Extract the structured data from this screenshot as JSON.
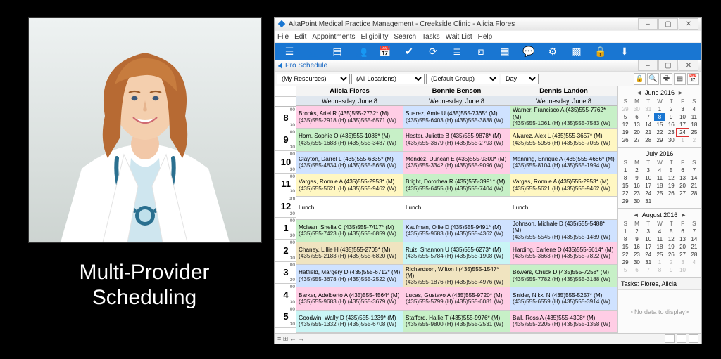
{
  "caption": "Multi-Provider Scheduling",
  "window": {
    "title": "AltaPoint Medical Practice Management - Creekside Clinic - Alicia Flores",
    "menu": [
      "File",
      "Edit",
      "Appointments",
      "Eligibility",
      "Search",
      "Tasks",
      "Wait List",
      "Help"
    ],
    "sub_title": "Pro Schedule",
    "filters": {
      "resources": "(My Resources)",
      "locations": "(All Locations)",
      "group": "(Default Group)",
      "view": "Day"
    }
  },
  "providers": [
    {
      "name": "Alicia Flores",
      "date": "Wednesday, June 8"
    },
    {
      "name": "Bonnie Benson",
      "date": "Wednesday, June 8"
    },
    {
      "name": "Dennis Landon",
      "date": "Wednesday, June 8"
    }
  ],
  "hours": [
    {
      "h": "8",
      "ampm": "00"
    },
    {
      "h": "9",
      "ampm": "00"
    },
    {
      "h": "10",
      "ampm": "00"
    },
    {
      "h": "11",
      "ampm": "00"
    },
    {
      "h": "12",
      "ampm": "pm"
    },
    {
      "h": "1",
      "ampm": "00"
    },
    {
      "h": "2",
      "ampm": "00"
    },
    {
      "h": "3",
      "ampm": "00"
    },
    {
      "h": "4",
      "ampm": "00"
    },
    {
      "h": "5",
      "ampm": "00"
    }
  ],
  "grid": [
    [
      {
        "c": "c-pink",
        "l1": "Brooks, Ariel R (435)555-2732* (M)",
        "l2": "(435)555-2918 (H) (435)555-6571 (W)"
      },
      {
        "c": "c-green",
        "l1": "Horn, Sophie O (435)555-1086* (M)",
        "l2": "(435)555-1683 (H) (435)555-3487 (W)"
      },
      {
        "c": "c-blue",
        "l1": "Clayton, Darrel L (435)555-6335* (M)",
        "l2": "(435)555-4834 (H) (435)555-5658 (W)"
      },
      {
        "c": "c-yellow",
        "l1": "Vargas, Ronnie A (435)555-2953* (M)",
        "l2": "(435)555-5621 (H) (435)555-9462 (W)"
      },
      {
        "c": "c-white",
        "l1": "Lunch",
        "l2": ""
      },
      {
        "c": "c-green",
        "l1": "Mclean, Shelia C (435)555-7417* (M)",
        "l2": "(435)555-7423 (H) (435)555-6859 (W)"
      },
      {
        "c": "c-tan",
        "l1": "Chaney, Lillie H (435)555-2705* (M)",
        "l2": "(435)555-2183 (H) (435)555-6820 (W)"
      },
      {
        "c": "c-blue",
        "l1": "Hatfield, Margery D (435)555-6712* (M)",
        "l2": "(435)555-3678 (H) (435)555-2522 (W)"
      },
      {
        "c": "c-pink",
        "l1": "Barker, Adelberto A (435)555-4564* (M)",
        "l2": "(435)555-9683 (H) (435)555-3679 (W)"
      },
      {
        "c": "c-cyan",
        "l1": "Goodwin, Wally D (435)555-1239* (M)",
        "l2": "(435)555-1332 (H) (435)555-6708 (W)"
      }
    ],
    [
      {
        "c": "c-blue",
        "l1": "Suarez, Amie U (435)555-7365* (M)",
        "l2": "(435)555-6403 (H) (435)555-3838 (W)"
      },
      {
        "c": "c-pink",
        "l1": "Hester, Juliette B (435)555-9878* (M)",
        "l2": "(435)555-3679 (H) (435)555-2793 (W)"
      },
      {
        "c": "c-pink",
        "l1": "Mendez, Duncan E (435)555-9300* (M)",
        "l2": "(435)555-3342 (H) (435)555-9096 (W)"
      },
      {
        "c": "c-green",
        "l1": "Bright, Dorothea R (435)555-3991* (M)",
        "l2": "(435)555-6455 (H) (435)555-7404 (W)"
      },
      {
        "c": "c-white",
        "l1": "Lunch",
        "l2": ""
      },
      {
        "c": "c-blue",
        "l1": "Kaufman, Ollie D (435)555-9491* (M)",
        "l2": "(435)555-9683 (H) (435)555-4362 (W)"
      },
      {
        "c": "c-cyan",
        "l1": "Ruiz, Shannon U (435)555-6273* (M)",
        "l2": "(435)555-5784 (H) (435)555-1908 (W)"
      },
      {
        "c": "c-tan",
        "l1": "Richardson, Wilton I (435)555-1547* (M)",
        "l2": "(435)555-1876 (H) (435)555-4976 (W)"
      },
      {
        "c": "c-pink",
        "l1": "Lucas, Gustavo A (435)555-9720* (M)",
        "l2": "(435)555-5799 (H) (435)555-6081 (W)"
      },
      {
        "c": "c-green",
        "l1": "Stafford, Hallie T (435)555-9976* (M)",
        "l2": "(435)555-9800 (H) (435)555-2531 (W)"
      }
    ],
    [
      {
        "c": "c-green",
        "l1": "Warner, Francisco A (435)555-7762* (M)",
        "l2": "(435)555-1061 (H) (435)555-7583 (W)"
      },
      {
        "c": "c-yellow",
        "l1": "Alvarez, Alex L (435)555-3657* (M)",
        "l2": "(435)555-5956 (H) (435)555-7055 (W)"
      },
      {
        "c": "c-blue",
        "l1": "Manning, Enrique A (435)555-4686* (M)",
        "l2": "(435)555-8104 (H) (435)555-1994 (W)"
      },
      {
        "c": "c-yellow",
        "l1": "Vargas, Ronnie A (435)555-2953* (M)",
        "l2": "(435)555-5621 (H) (435)555-9462 (W)"
      },
      {
        "c": "c-white",
        "l1": "Lunch",
        "l2": ""
      },
      {
        "c": "c-blue",
        "l1": "Johnson, Michale D (435)555-5488* (M)",
        "l2": "(435)555-5545 (H) (435)555-1489 (W)"
      },
      {
        "c": "c-pink",
        "l1": "Harding, Earlene D (435)555-5614* (M)",
        "l2": "(435)555-3663 (H) (435)555-7822 (W)"
      },
      {
        "c": "c-green",
        "l1": "Bowers, Chuck D (435)555-7258* (M)",
        "l2": "(435)555-7782 (H) (435)555-3188 (W)"
      },
      {
        "c": "c-blue",
        "l1": "Snider, Nikki N (435)555-5257* (M)",
        "l2": "(435)555-6559 (H) (435)555-3914 (W)"
      },
      {
        "c": "c-pink",
        "l1": "Ball, Ross A (435)555-4308* (M)",
        "l2": "(435)555-2205 (H) (435)555-1358 (W)"
      }
    ]
  ],
  "calendars": [
    {
      "title": "June 2016",
      "pre": [
        29,
        30,
        31
      ],
      "start": 1,
      "end": 30,
      "post": [
        1,
        2
      ],
      "highlight": 8,
      "box": 24,
      "arrows": true
    },
    {
      "title": "July 2016",
      "pre": [],
      "start": 1,
      "end": 31,
      "post": [],
      "highlight": null,
      "box": null,
      "arrows": false
    },
    {
      "title": "August 2016",
      "pre": [],
      "start": 1,
      "end": 31,
      "post": [
        1,
        2,
        3,
        4,
        5,
        6,
        7,
        8,
        9,
        10
      ],
      "highlight": null,
      "box": null,
      "arrows": true
    }
  ],
  "dow": [
    "S",
    "M",
    "T",
    "W",
    "T",
    "F",
    "S"
  ],
  "tasks": {
    "header": "Tasks: Flores, Alicia",
    "empty": "<No data to display>"
  },
  "status_left": [
    "≡",
    "⊞",
    "←",
    "→"
  ]
}
